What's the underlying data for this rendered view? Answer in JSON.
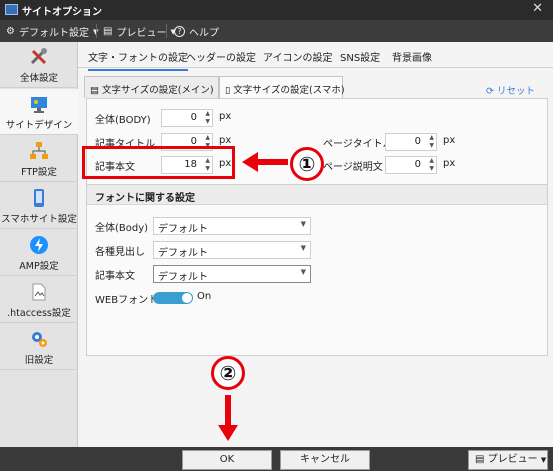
{
  "window": {
    "title": "サイトオプション",
    "close": "✕"
  },
  "menubar": {
    "default_settings": "デフォルト設定",
    "preview": "プレビュー",
    "help": "ヘルプ"
  },
  "sidebar": {
    "items": [
      {
        "label": "全体設定"
      },
      {
        "label": "サイトデザイン"
      },
      {
        "label": "FTP設定"
      },
      {
        "label": "スマホサイト設定"
      },
      {
        "label": "AMP設定"
      },
      {
        "label": ".htaccess設定"
      },
      {
        "label": "旧設定"
      }
    ]
  },
  "main_tabs": [
    "文字・フォントの設定",
    "ヘッダーの設定",
    "アイコンの設定",
    "SNS設定",
    "背景画像"
  ],
  "sub_tabs": [
    "文字サイズの設定(メイン)",
    "文字サイズの設定(スマホ)"
  ],
  "reset_label": "リセット",
  "size_fields": {
    "body_label": "全体(BODY)",
    "body_value": "0",
    "article_title_label": "記事タイトル",
    "article_title_value": "0",
    "article_body_label": "記事本文",
    "article_body_value": "18",
    "page_title_label": "ページタイトル",
    "page_title_value": "0",
    "page_desc_label": "ページ説明文",
    "page_desc_value": "0",
    "unit": "px"
  },
  "font_panel": {
    "heading": "フォントに関する設定",
    "body_label": "全体(Body)",
    "body_value": "デフォルト",
    "headings_label": "各種見出し",
    "headings_value": "デフォルト",
    "article_label": "記事本文",
    "article_value": "デフォルト",
    "web_font_label": "WEBフォント",
    "web_font_state": "On"
  },
  "annotations": {
    "one": "①",
    "two": "②"
  },
  "footer": {
    "ok": "OK",
    "cancel": "キャンセル",
    "preview": "プレビュー"
  },
  "colors": {
    "accent": "#3a7bd5",
    "annotation_red": "#e8000b",
    "dark_bar": "#3c3c3c"
  }
}
